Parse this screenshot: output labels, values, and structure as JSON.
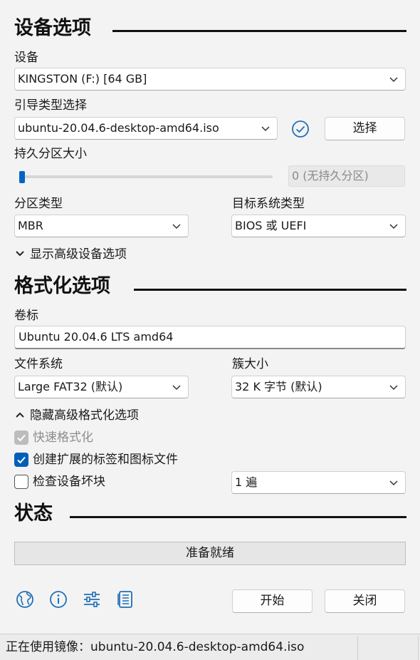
{
  "device_section": {
    "title": "设备选项",
    "device_label": "设备",
    "device_value": "KINGSTON (F:) [64 GB]",
    "boot_label": "引导类型选择",
    "boot_value": "ubuntu-20.04.6-desktop-amd64.iso",
    "select_button": "选择",
    "persistent_label": "持久分区大小",
    "persistent_value": "0 (无持久分区)",
    "persistent_level": 0,
    "partition_label": "分区类型",
    "partition_value": "MBR",
    "target_label": "目标系统类型",
    "target_value": "BIOS 或 UEFI",
    "advanced_toggle": "显示高级设备选项"
  },
  "format_section": {
    "title": "格式化选项",
    "volume_label": "卷标",
    "volume_value": "Ubuntu 20.04.6 LTS amd64",
    "fs_label": "文件系统",
    "fs_value": "Large FAT32 (默认)",
    "cluster_label": "簇大小",
    "cluster_value": "32 K 字节 (默认)",
    "advanced_toggle": "隐藏高级格式化选项",
    "quick_format": "快速格式化",
    "extended_label": "创建扩展的标签和图标文件",
    "check_bad_blocks": "检查设备坏块",
    "passes_value": "1 遍"
  },
  "status_section": {
    "title": "状态",
    "progress_text": "准备就绪",
    "progress_level": 0
  },
  "actions": {
    "start_button": "开始",
    "close_button": "关闭"
  },
  "statusbar": {
    "text": "正在使用镜像：ubuntu-20.04.6-desktop-amd64.iso"
  },
  "colors": {
    "accent": "#005fb8",
    "icon_blue": "#1f6fb8"
  },
  "icons": [
    "globe-icon",
    "info-icon",
    "settings-sliders-icon",
    "log-icon",
    "verify-check-icon"
  ]
}
